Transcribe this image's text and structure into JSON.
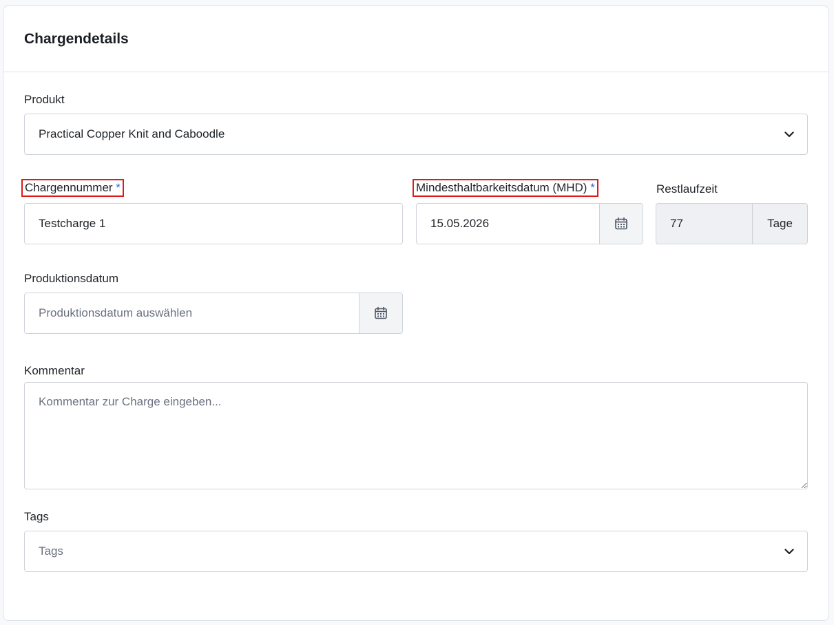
{
  "card": {
    "title": "Chargendetails"
  },
  "produkt": {
    "label": "Produkt",
    "value": "Practical Copper Knit and Caboodle"
  },
  "chargennummer": {
    "label": "Chargennummer",
    "required_mark": "*",
    "value": "Testcharge 1"
  },
  "mhd": {
    "label": "Mindesthaltbarkeitsdatum (MHD)",
    "required_mark": "*",
    "value": "15.05.2026"
  },
  "restlaufzeit": {
    "label": "Restlaufzeit",
    "value": "77",
    "unit": "Tage"
  },
  "produktionsdatum": {
    "label": "Produktionsdatum",
    "placeholder": "Produktionsdatum auswählen"
  },
  "kommentar": {
    "label": "Kommentar",
    "placeholder": "Kommentar zur Charge eingeben..."
  },
  "tags": {
    "label": "Tags",
    "placeholder": "Tags"
  },
  "colors": {
    "required": "#2f6fd8",
    "highlight": "#e01919",
    "border": "#cfd3da",
    "readonly_bg": "#eff0f3"
  },
  "icons": {
    "dropdown": "chevron-down-icon",
    "date": "calendar-icon"
  }
}
